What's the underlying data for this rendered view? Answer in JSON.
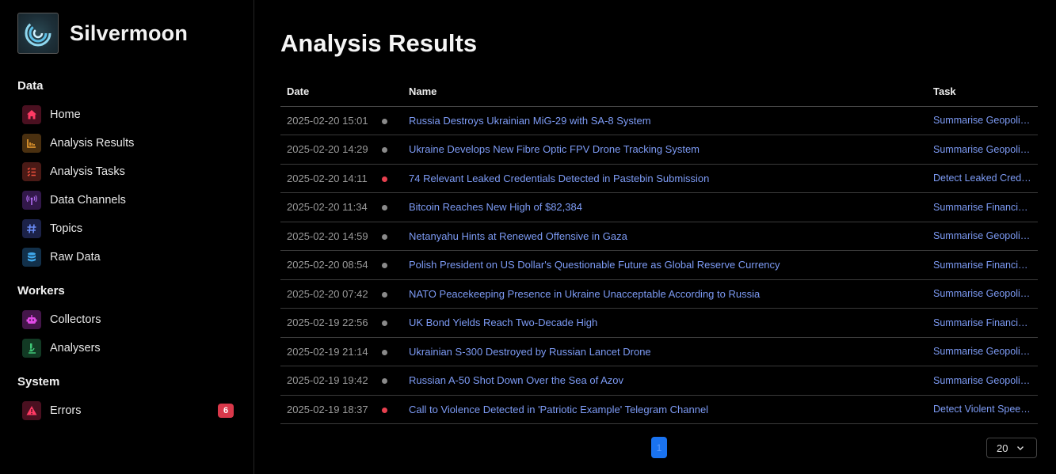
{
  "app": {
    "name": "Silvermoon"
  },
  "sidebar": {
    "sections": [
      {
        "title": "Data"
      },
      {
        "title": "Workers"
      },
      {
        "title": "System"
      }
    ],
    "items": [
      {
        "label": "Home",
        "icon": "home-icon",
        "color": "#e8355a"
      },
      {
        "label": "Analysis Results",
        "icon": "chart-icon",
        "color": "#e0982a"
      },
      {
        "label": "Analysis Tasks",
        "icon": "task-list-icon",
        "color": "#e8463a"
      },
      {
        "label": "Data Channels",
        "icon": "antenna-icon",
        "color": "#a05ce8"
      },
      {
        "label": "Topics",
        "icon": "hash-icon",
        "color": "#5a7ef0"
      },
      {
        "label": "Raw Data",
        "icon": "database-icon",
        "color": "#3aa0e0"
      },
      {
        "label": "Collectors",
        "icon": "robot-icon",
        "color": "#d24ad8"
      },
      {
        "label": "Analysers",
        "icon": "microscope-icon",
        "color": "#3ac070"
      },
      {
        "label": "Errors",
        "icon": "warning-icon",
        "color": "#e8355a",
        "badge": "6"
      }
    ]
  },
  "main": {
    "title": "Analysis Results",
    "table": {
      "headers": {
        "date": "Date",
        "name": "Name",
        "task": "Task"
      },
      "rows": [
        {
          "date": "2025-02-20 15:01",
          "status": "grey",
          "name": "Russia Destroys Ukrainian MiG-29 with SA-8 System",
          "task": "Summarise Geopoli…"
        },
        {
          "date": "2025-02-20 14:29",
          "status": "grey",
          "name": "Ukraine Develops New Fibre Optic FPV Drone Tracking System",
          "task": "Summarise Geopoli…"
        },
        {
          "date": "2025-02-20 14:11",
          "status": "red",
          "name": "74 Relevant Leaked Credentials Detected in Pastebin Submission",
          "task": "Detect Leaked Cred…"
        },
        {
          "date": "2025-02-20 11:34",
          "status": "grey",
          "name": "Bitcoin Reaches New High of $82,384",
          "task": "Summarise Financi…"
        },
        {
          "date": "2025-02-20 14:59",
          "status": "grey",
          "name": "Netanyahu Hints at Renewed Offensive in Gaza",
          "task": "Summarise Geopoli…"
        },
        {
          "date": "2025-02-20 08:54",
          "status": "grey",
          "name": "Polish President on US Dollar's Questionable Future as Global Reserve Currency",
          "task": "Summarise Financi…"
        },
        {
          "date": "2025-02-20 07:42",
          "status": "grey",
          "name": "NATO Peacekeeping Presence in Ukraine Unacceptable According to Russia",
          "task": "Summarise Geopoli…"
        },
        {
          "date": "2025-02-19 22:56",
          "status": "grey",
          "name": "UK Bond Yields Reach Two-Decade High",
          "task": "Summarise Financi…"
        },
        {
          "date": "2025-02-19 21:14",
          "status": "grey",
          "name": "Ukrainian S-300 Destroyed by Russian Lancet Drone",
          "task": "Summarise Geopoli…"
        },
        {
          "date": "2025-02-19 19:42",
          "status": "grey",
          "name": "Russian A-50 Shot Down Over the Sea of Azov",
          "task": "Summarise Geopoli…"
        },
        {
          "date": "2025-02-19 18:37",
          "status": "red",
          "name": "Call to Violence Detected in 'Patriotic Example' Telegram Channel",
          "task": "Detect Violent Spee…"
        }
      ]
    },
    "pagination": {
      "current": "1",
      "page_size": "20"
    }
  },
  "colors": {
    "status_grey": "#8a8a8a",
    "status_red": "#e8404f",
    "link": "#7d9bf5"
  }
}
